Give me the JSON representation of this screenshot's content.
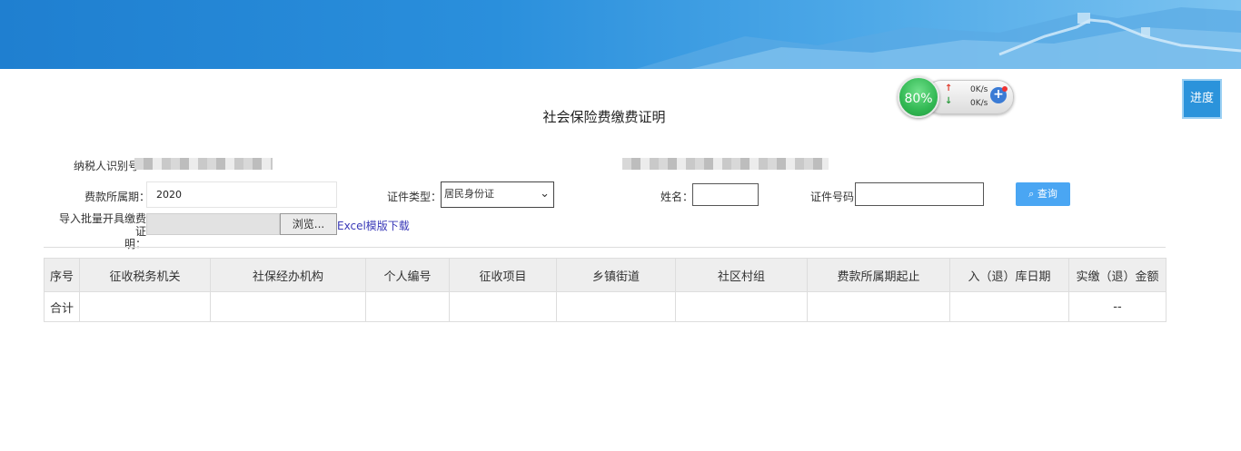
{
  "page_title": "社会保险费缴费证明",
  "net_widget": {
    "percent": "80%",
    "upload_speed": "0K/s",
    "download_speed": "0K/s"
  },
  "progress_button": "进度",
  "form": {
    "taxpayer_id_label": "纳税人识别号",
    "period_label": "费款所属期：",
    "period_value": "2020",
    "id_type_label": "证件类型：",
    "id_type_value": "居民身份证",
    "name_label": "姓名：",
    "id_number_label": "证件号码:",
    "query_button": "查询",
    "import_label_line1": "导入批量开具缴费证",
    "import_label_line2": "明：",
    "browse_button": "浏览...",
    "excel_template_link": "Excel模版下载"
  },
  "table": {
    "headers": [
      "序号",
      "征收税务机关",
      "社保经办机构",
      "个人编号",
      "征收项目",
      "乡镇街道",
      "社区村组",
      "费款所属期起止",
      "入（退）库日期",
      "实缴（退）金额"
    ],
    "rows": [
      [
        "合计",
        "",
        "",
        "",
        "",
        "",
        "",
        "",
        "",
        "--"
      ]
    ]
  }
}
